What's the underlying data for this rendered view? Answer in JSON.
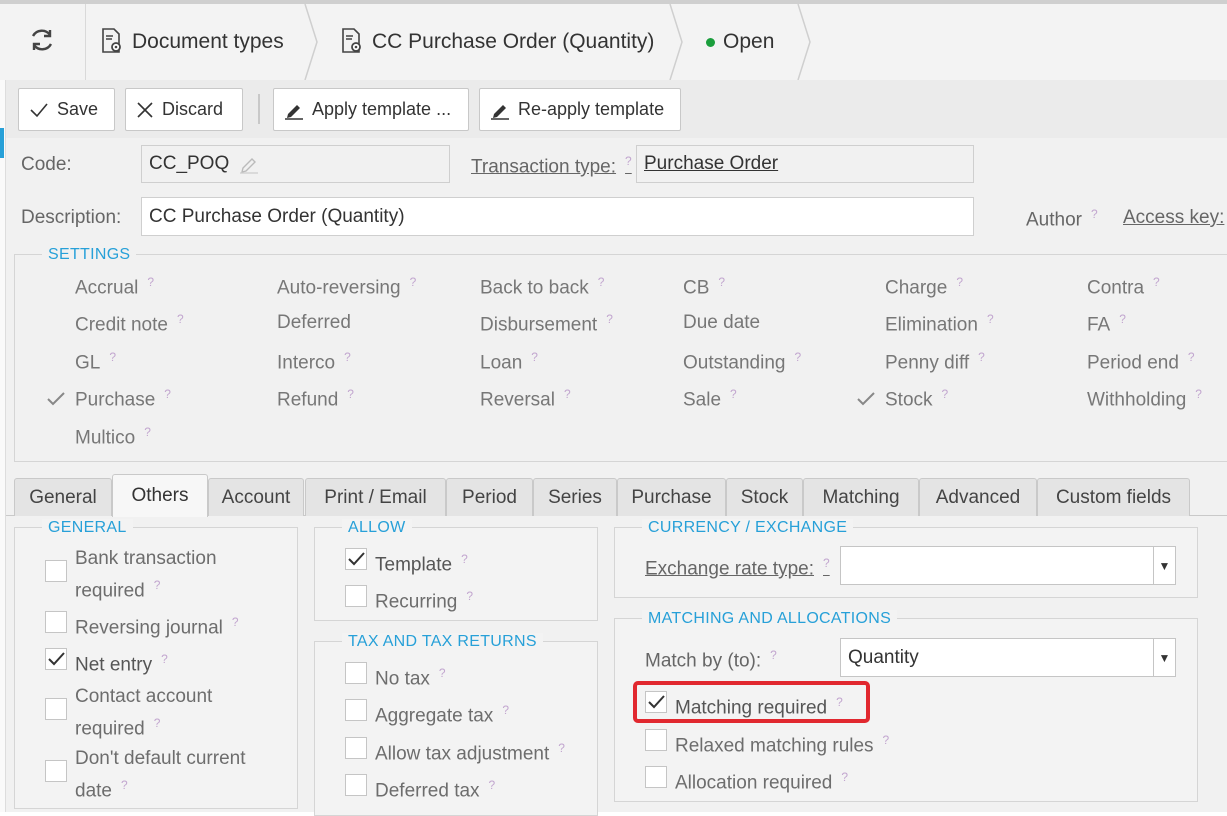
{
  "breadcrumb": {
    "items": [
      {
        "label": "Document types"
      },
      {
        "label": "CC Purchase Order (Quantity)"
      },
      {
        "label": "Open"
      }
    ]
  },
  "toolbar": {
    "save": "Save",
    "discard": "Discard",
    "apply_template": "Apply template ...",
    "reapply_template": "Re-apply template"
  },
  "form": {
    "code_label": "Code:",
    "code_value": "CC_POQ",
    "transaction_type_label": "Transaction type:",
    "transaction_type_value": "Purchase Order",
    "description_label": "Description:",
    "description_value": "CC Purchase Order (Quantity)",
    "author_label": "Author",
    "access_key_label": "Access key:",
    "help": "?"
  },
  "settings": {
    "title": "SETTINGS",
    "items": [
      {
        "label": "Accrual",
        "checked": false,
        "help": true
      },
      {
        "label": "Auto-reversing",
        "checked": false,
        "help": true
      },
      {
        "label": "Back to back",
        "checked": false,
        "help": true
      },
      {
        "label": "CB",
        "checked": false,
        "help": true
      },
      {
        "label": "Charge",
        "checked": false,
        "help": true
      },
      {
        "label": "Contra",
        "checked": false,
        "help": true
      },
      {
        "label": "Credit note",
        "checked": false,
        "help": true
      },
      {
        "label": "Deferred",
        "checked": false,
        "help": false
      },
      {
        "label": "Disbursement",
        "checked": false,
        "help": true
      },
      {
        "label": "Due date",
        "checked": false,
        "help": false
      },
      {
        "label": "Elimination",
        "checked": false,
        "help": true
      },
      {
        "label": "FA",
        "checked": false,
        "help": true
      },
      {
        "label": "GL",
        "checked": false,
        "help": true
      },
      {
        "label": "Interco",
        "checked": false,
        "help": true
      },
      {
        "label": "Loan",
        "checked": false,
        "help": true
      },
      {
        "label": "Outstanding",
        "checked": false,
        "help": true
      },
      {
        "label": "Penny diff",
        "checked": false,
        "help": true
      },
      {
        "label": "Period end",
        "checked": false,
        "help": true
      },
      {
        "label": "Purchase",
        "checked": true,
        "help": true
      },
      {
        "label": "Refund",
        "checked": false,
        "help": true
      },
      {
        "label": "Reversal",
        "checked": false,
        "help": true
      },
      {
        "label": "Sale",
        "checked": false,
        "help": true
      },
      {
        "label": "Stock",
        "checked": true,
        "help": true
      },
      {
        "label": "Withholding",
        "checked": false,
        "help": true
      },
      {
        "label": "Multico",
        "checked": false,
        "help": true
      }
    ]
  },
  "tabs": [
    {
      "label": "General",
      "active": false
    },
    {
      "label": "Others",
      "active": true
    },
    {
      "label": "Account",
      "active": false
    },
    {
      "label": "Print / Email",
      "active": false
    },
    {
      "label": "Period",
      "active": false
    },
    {
      "label": "Series",
      "active": false
    },
    {
      "label": "Purchase",
      "active": false
    },
    {
      "label": "Stock",
      "active": false
    },
    {
      "label": "Matching",
      "active": false
    },
    {
      "label": "Advanced",
      "active": false
    },
    {
      "label": "Custom fields",
      "active": false
    }
  ],
  "general": {
    "title": "GENERAL",
    "items": [
      {
        "line1": "Bank transaction",
        "line2": "required",
        "checked": false
      },
      {
        "line1": "Reversing journal",
        "line2": "",
        "checked": false
      },
      {
        "line1": "Net entry",
        "line2": "",
        "checked": true
      },
      {
        "line1": "Contact account",
        "line2": "required",
        "checked": false
      },
      {
        "line1": "Don't default current",
        "line2": "date",
        "checked": false
      }
    ]
  },
  "allow": {
    "title": "ALLOW",
    "items": [
      {
        "label": "Template",
        "checked": true
      },
      {
        "label": "Recurring",
        "checked": false
      }
    ]
  },
  "tax": {
    "title": "TAX AND TAX RETURNS",
    "items": [
      {
        "label": "No tax",
        "checked": false
      },
      {
        "label": "Aggregate tax",
        "checked": false
      },
      {
        "label": "Allow tax adjustment",
        "checked": false
      },
      {
        "label": "Deferred tax",
        "checked": false
      }
    ]
  },
  "currency": {
    "title": "CURRENCY / EXCHANGE",
    "exchange_rate_type_label": "Exchange rate type:",
    "exchange_rate_type_value": ""
  },
  "matching": {
    "title": "MATCHING AND ALLOCATIONS",
    "match_by_label": "Match by (to):",
    "match_by_value": "Quantity",
    "items": [
      {
        "label": "Matching required",
        "checked": true
      },
      {
        "label": "Relaxed matching rules",
        "checked": false
      },
      {
        "label": "Allocation required",
        "checked": false
      }
    ]
  },
  "colors": {
    "accent": "#27a0d8",
    "highlight": "#e1282f",
    "status_open": "#1a9e3c"
  }
}
